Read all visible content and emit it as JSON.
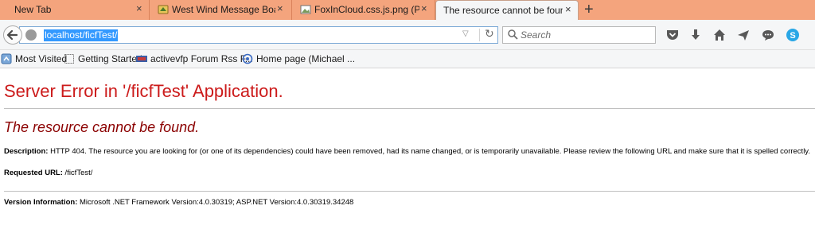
{
  "tabs": [
    {
      "label": "New Tab",
      "active": false
    },
    {
      "label": "West Wind Message Board",
      "active": false
    },
    {
      "label": "FoxInCloud.css.js.png (PN...",
      "active": false
    },
    {
      "label": "The resource cannot be found.",
      "active": true
    }
  ],
  "new_tab_glyph": "+",
  "close_glyph": "×",
  "urlbar": {
    "value": "localhost/ficfTest/"
  },
  "searchbar": {
    "placeholder": "Search"
  },
  "bookmarks": [
    {
      "label": "Most Visited",
      "icon": "most-visited-icon"
    },
    {
      "label": "Getting Started",
      "icon": "page-icon"
    },
    {
      "label": "activevfp Forum Rss F...",
      "icon": "rss-icon"
    },
    {
      "label": "Home page (Michael ...",
      "icon": "home-page-icon"
    }
  ],
  "page": {
    "title": "Server Error in '/ficfTest' Application.",
    "subtitle": "The resource cannot be found.",
    "description_label": "Description:",
    "description_text": "HTTP 404. The resource you are looking for (or one of its dependencies) could have been removed, had its name changed, or is temporarily unavailable.  Please review the following URL and make sure that it is spelled correctly.",
    "requested_url_label": "Requested URL:",
    "requested_url_value": "/ficfTest/",
    "version_label": "Version Information:",
    "version_value": "Microsoft .NET Framework Version:4.0.30319; ASP.NET Version:4.0.30319.34248"
  },
  "colors": {
    "tabstrip": "#f4a47d",
    "error_title": "#cc1b1b",
    "error_subtitle": "#8b0000",
    "url_highlight": "#3399ff"
  }
}
